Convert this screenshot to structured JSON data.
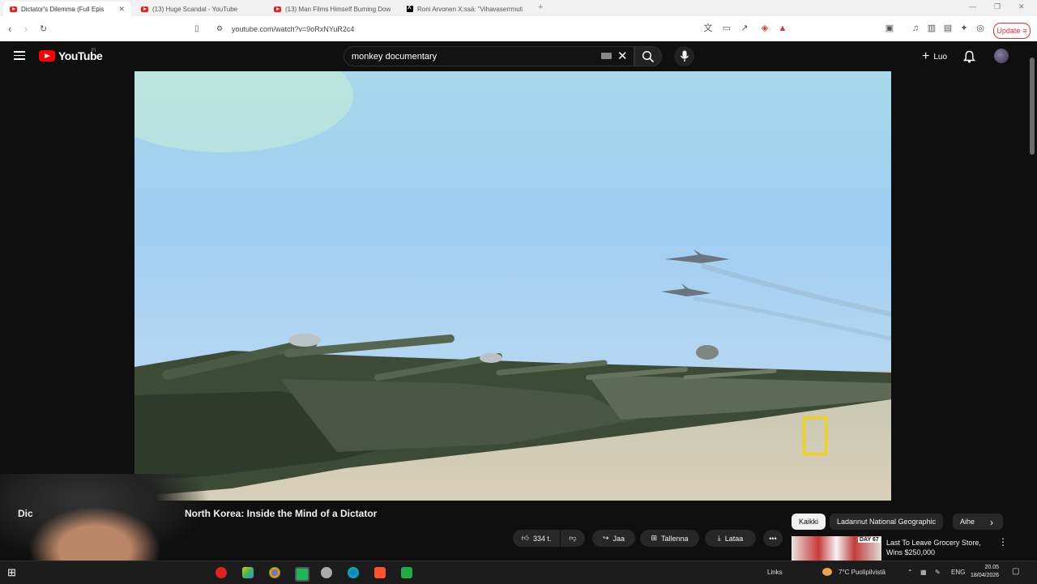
{
  "browser": {
    "tabs": [
      {
        "label": "Dictator's Dilemma (Full Epis",
        "favicon": "youtube-icon",
        "active": true
      },
      {
        "label": "(13) Huge Scandal - YouTube",
        "favicon": "youtube-icon",
        "active": false
      },
      {
        "label": "(13) Man Films Himself Burning Dow",
        "favicon": "youtube-icon",
        "active": false
      },
      {
        "label": "Roni Arvonen X:ssä: \"Vihavaserrmuti",
        "favicon": "x-icon",
        "active": false
      }
    ],
    "url": "youtube.com/watch?v=9oRxNYuR2c4",
    "update_label": "Update"
  },
  "youtube": {
    "logo_text": "YouTube",
    "country_code": "FI",
    "search_value": "monkey documentary",
    "create_label": "Luo"
  },
  "video": {
    "title_prefix": "Dic",
    "title": "North Korea: Inside the Mind of a Dictator",
    "likes": "334 t.",
    "share_label": "Jaa",
    "save_label": "Tallenna",
    "download_label": "Lataa"
  },
  "chips": [
    "Kaikki",
    "Ladannut National Geographic",
    "Aihe"
  ],
  "recommendation": {
    "title": "Last To Leave Grocery Store, Wins $250,000",
    "thumb_badge": "DAY 67"
  },
  "taskbar": {
    "links_label": "Links",
    "weather": "7°C  Puolipilvistä",
    "language": "ENG",
    "time": "20.05",
    "date": "18/04/2026"
  },
  "colors": {
    "youtube_red": "#ff0000",
    "natgeo_yellow": "#f5d20c",
    "background": "#0f0f0f"
  }
}
